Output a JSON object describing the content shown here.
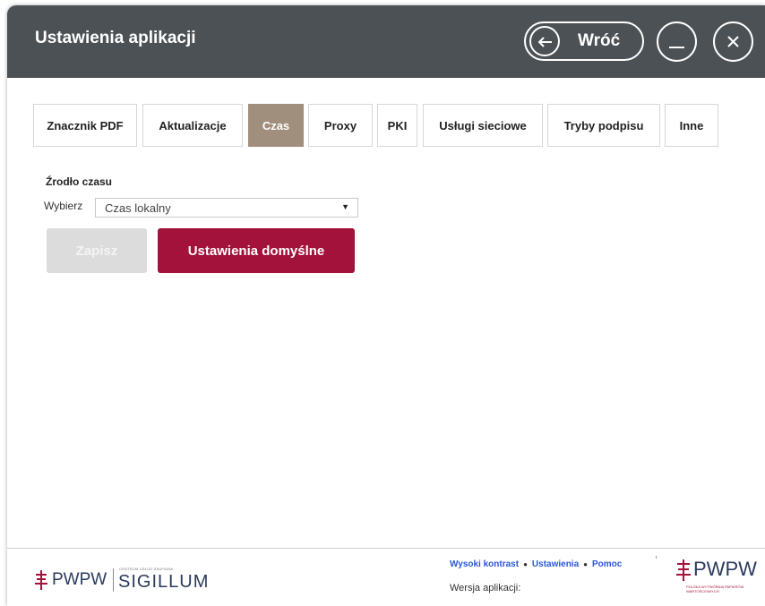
{
  "window": {
    "title": "Ustawienia aplikacji",
    "back_label": "Wróć"
  },
  "tabs": [
    {
      "label": "Znacznik PDF",
      "active": false
    },
    {
      "label": "Aktualizacje",
      "active": false
    },
    {
      "label": "Czas",
      "active": true
    },
    {
      "label": "Proxy",
      "active": false
    },
    {
      "label": "PKI",
      "active": false
    },
    {
      "label": "Usługi sieciowe",
      "active": false
    },
    {
      "label": "Tryby podpisu",
      "active": false
    },
    {
      "label": "Inne",
      "active": false
    }
  ],
  "time_source": {
    "section_label": "Źrodło czasu",
    "select_label": "Wybierz",
    "selected": "Czas lokalny"
  },
  "actions": {
    "save_label": "Zapisz",
    "defaults_label": "Ustawienia domyślne"
  },
  "footer": {
    "logo_left": "PWPW",
    "logo_small": "CENTRUM USŁUG ZAUFANIA",
    "logo_product": "SIGILLUM",
    "links": [
      "Wysoki kontrast",
      "Ustawienia",
      "Pomoc"
    ],
    "version_label": "Wersja aplikacji:",
    "logo_right": "PWPW",
    "logo_right_sub": "POLSKA WYTWÓRNIA PAPIERÓW WARTOŚCIOWYCH"
  },
  "colors": {
    "titlebar": "#4c5155",
    "active_tab": "#a08f7c",
    "primary": "#a3123a",
    "link": "#2a58d6",
    "disabled": "#dcdcdc"
  }
}
